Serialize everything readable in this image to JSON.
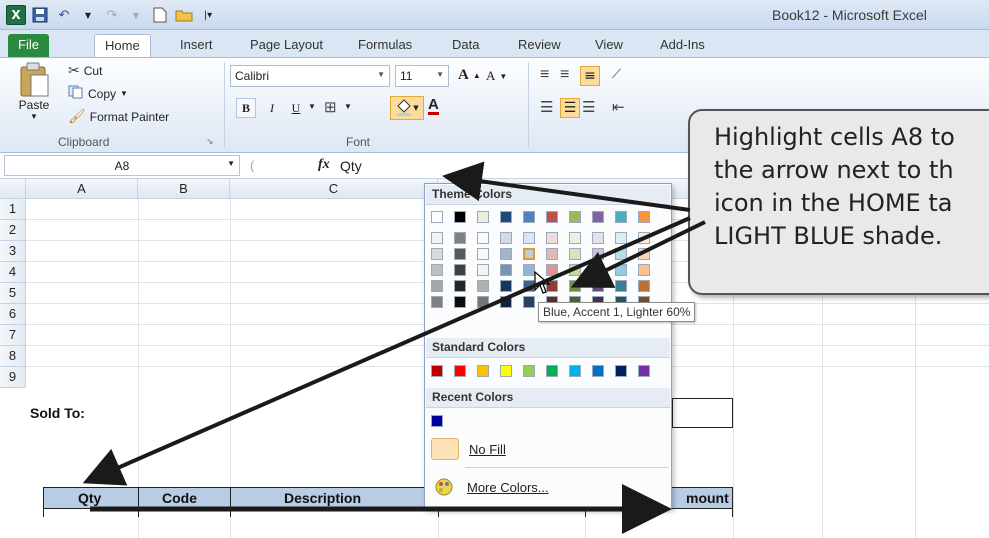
{
  "window": {
    "title": "Book12 - Microsoft Excel",
    "app_icon": "X"
  },
  "tabs": [
    "File",
    "Home",
    "Insert",
    "Page Layout",
    "Formulas",
    "Data",
    "Review",
    "View",
    "Add-Ins"
  ],
  "clipboard": {
    "paste": "Paste",
    "cut": "Cut",
    "copy": "Copy",
    "format_painter": "Format Painter",
    "group_label": "Clipboard"
  },
  "font": {
    "name": "Calibri",
    "size": "11",
    "group_label": "Font",
    "bold": "B",
    "italic": "I",
    "underline": "U",
    "grow": "A",
    "shrink": "A",
    "font_color": "A"
  },
  "formula_bar": {
    "name_box": "A8",
    "fx": "fx",
    "value": "Qty"
  },
  "columns": [
    "A",
    "B",
    "C"
  ],
  "rows": [
    "1",
    "2",
    "3",
    "4",
    "5",
    "6",
    "7",
    "8",
    "9"
  ],
  "cells": {
    "a5": "Sold To:",
    "a8": "Qty",
    "b8": "Code",
    "c8": "Description",
    "e8": "mount"
  },
  "dropdown": {
    "theme_title": "Theme Colors",
    "standard_title": "Standard Colors",
    "recent_title": "Recent Colors",
    "no_fill": "No Fill",
    "more_colors": "More Colors...",
    "tooltip": "Blue, Accent 1, Lighter 60%",
    "theme_top": [
      "#ffffff",
      "#000000",
      "#eeece1",
      "#1f497d",
      "#4f81bd",
      "#c0504d",
      "#9bbb59",
      "#8064a2",
      "#4bacc6",
      "#f79646"
    ],
    "standard": [
      "#c00000",
      "#ff0000",
      "#ffc000",
      "#ffff00",
      "#92d050",
      "#00b050",
      "#00b0f0",
      "#0070c0",
      "#002060",
      "#7030a0"
    ],
    "recent": [
      "#0000a0"
    ]
  },
  "callout": {
    "text": "Highlight cells A8 to\nthe arrow next to th\nicon in the HOME ta\nLIGHT BLUE shade."
  },
  "colors": {
    "file_tab": "#2a8a3f",
    "header_fill": "#b8cce4",
    "arrow": "#1a1a1a"
  }
}
